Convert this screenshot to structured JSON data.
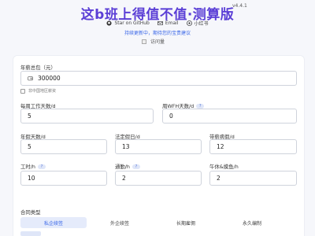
{
  "header": {
    "title": "这b班上得值不值·测算版",
    "version": "v4.4.1",
    "links": [
      {
        "icon": "github-icon",
        "label": "Star on GitHub"
      },
      {
        "icon": "email-icon",
        "label": "Email"
      },
      {
        "icon": "xiaohongshu-icon",
        "label": "小红书"
      }
    ],
    "subtitle": "持续更新中，期待您的宝贵建议",
    "visits_label": "访问量"
  },
  "form": {
    "salary": {
      "label": "年薪总包（元）",
      "value": "300000",
      "icon": "wallet-icon"
    },
    "non_china_checkbox": {
      "label": "非中国地区薪资",
      "checked": false
    },
    "work_days": {
      "label": "每周工作天数/d",
      "value": "5"
    },
    "wfh_days": {
      "label": "周WFH天数/d",
      "help": "?",
      "value": "0"
    },
    "annual_leave": {
      "label": "年假天数/d",
      "value": "5"
    },
    "public_holidays": {
      "label": "法定假日/d",
      "value": "13"
    },
    "paid_sick_leave": {
      "label": "带薪病假/d",
      "value": "12"
    },
    "work_hours": {
      "label": "工时/h",
      "help": "?",
      "value": "10"
    },
    "commute_hours": {
      "label": "通勤/h",
      "help": "?",
      "value": "2"
    },
    "rest_hours": {
      "label": "午休&摸鱼/h",
      "value": "2"
    },
    "contract_type": {
      "label": "合同类型",
      "options": [
        "私企续签",
        "外企续签",
        "长期雇佣",
        "永久编制"
      ],
      "selected": "私企续签"
    }
  },
  "colors": {
    "accent": "#5b3fd6",
    "link": "#3a67e8",
    "tab_active_bg": "#e5ebfb"
  }
}
